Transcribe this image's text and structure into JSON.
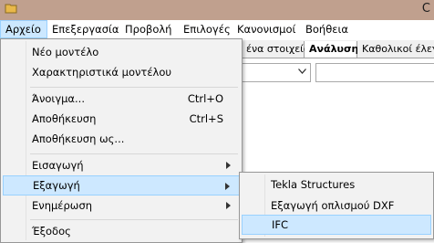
{
  "window": {
    "title_fragment": "C"
  },
  "menubar": {
    "items": [
      {
        "label": "Αρχείο"
      },
      {
        "label": "Επεξεργασία"
      },
      {
        "label": "Προβολή"
      },
      {
        "label": "Επιλογές"
      },
      {
        "label": "Κανονισμοί"
      },
      {
        "label": "Βοήθεια"
      }
    ]
  },
  "tabs": [
    {
      "label": "ένα στοιχεία"
    },
    {
      "label": "Ανάλυση"
    },
    {
      "label": "Καθολικοί έλεγχ"
    }
  ],
  "file_menu": {
    "items": [
      {
        "label": "Νέο μοντέλο"
      },
      {
        "label": "Χαρακτηριστικά μοντέλου"
      },
      {
        "label": "Άνοιγμα...",
        "shortcut": "Ctrl+O"
      },
      {
        "label": "Αποθήκευση",
        "shortcut": "Ctrl+S"
      },
      {
        "label": "Αποθήκευση ως..."
      },
      {
        "label": "Εισαγωγή"
      },
      {
        "label": "Εξαγωγή"
      },
      {
        "label": "Ενημέρωση"
      },
      {
        "label": "Έξοδος"
      }
    ]
  },
  "export_submenu": {
    "items": [
      {
        "label": "Tekla Structures"
      },
      {
        "label": "Εξαγωγή οπλισμού DXF"
      },
      {
        "label": "IFC"
      }
    ]
  }
}
